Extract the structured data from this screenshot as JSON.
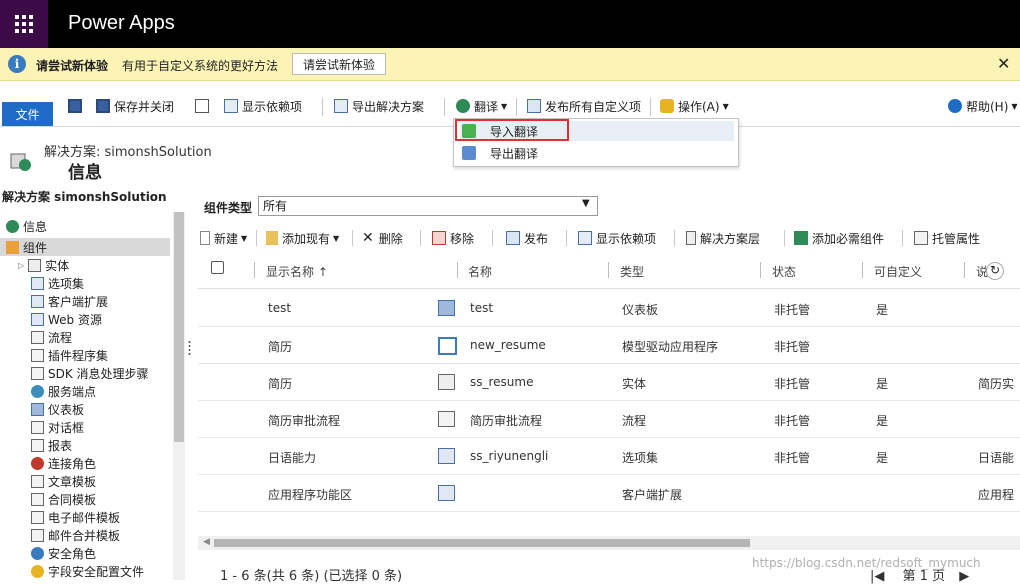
{
  "app": {
    "title": "Power Apps"
  },
  "notice": {
    "title": "请尝试新体验",
    "description": "有用于自定义系统的更好方法",
    "button": "请尝试新体验"
  },
  "ribbon": {
    "file": "文件",
    "save_close": "保存并关闭",
    "show_deps": "显示依赖项",
    "export_solution": "导出解决方案",
    "translate": "翻译",
    "publish_all": "发布所有自定义项",
    "actions": "操作(A)",
    "help": "帮助(H)"
  },
  "dropdown": {
    "items": [
      "导入翻译",
      "导出翻译"
    ]
  },
  "header": {
    "solution_label": "解决方案: simonshSolution",
    "page_title": "信息"
  },
  "nav": {
    "heading": "解决方案 simonshSolution",
    "items": [
      "信息",
      "组件",
      "实体",
      "选项集",
      "客户端扩展",
      "Web 资源",
      "流程",
      "插件程序集",
      "SDK 消息处理步骤",
      "服务端点",
      "仪表板",
      "对话框",
      "报表",
      "连接角色",
      "文章模板",
      "合同模板",
      "电子邮件模板",
      "邮件合并模板",
      "安全角色",
      "字段安全配置文件"
    ]
  },
  "filter": {
    "label": "组件类型",
    "value": "所有"
  },
  "toolbar": {
    "new": "新建",
    "add_existing": "添加现有",
    "delete": "删除",
    "remove": "移除",
    "publish": "发布",
    "show_deps": "显示依赖项",
    "solution_layers": "解决方案层",
    "add_required": "添加必需组件",
    "managed_props": "托管属性"
  },
  "grid": {
    "columns": [
      "显示名称 ↑",
      "名称",
      "类型",
      "状态",
      "可自定义",
      "说"
    ],
    "rows": [
      [
        "test",
        "test",
        "仪表板",
        "非托管",
        "是",
        ""
      ],
      [
        "简历",
        "new_resume",
        "模型驱动应用程序",
        "非托管",
        "",
        ""
      ],
      [
        "简历",
        "ss_resume",
        "实体",
        "非托管",
        "是",
        "简历实"
      ],
      [
        "简历审批流程",
        "简历审批流程",
        "流程",
        "非托管",
        "是",
        ""
      ],
      [
        "日语能力",
        "ss_riyunengli",
        "选项集",
        "非托管",
        "是",
        "日语能"
      ],
      [
        "应用程序功能区",
        "",
        "客户端扩展",
        "",
        "",
        "应用程"
      ]
    ]
  },
  "footer": {
    "count": "1 - 6  条(共 6 条) (已选择 0 条)",
    "page": "第 1 页"
  },
  "watermark": "https://blog.csdn.net/redsoft_mymuch",
  "colors": {
    "accent": "#1f6cc7",
    "notice_bg": "#fcf4b4",
    "highlight": "#e03030"
  }
}
